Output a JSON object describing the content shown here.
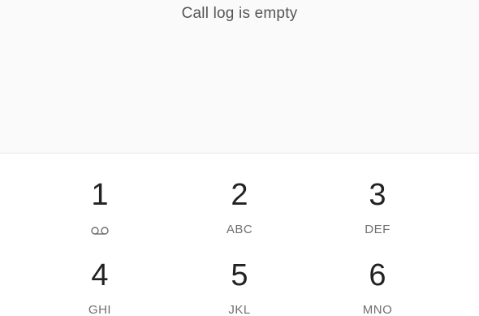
{
  "calllog": {
    "empty_message": "Call log is empty"
  },
  "keypad": {
    "keys": [
      {
        "digit": "1",
        "letters": "",
        "icon": "voicemail-icon"
      },
      {
        "digit": "2",
        "letters": "ABC"
      },
      {
        "digit": "3",
        "letters": "DEF"
      },
      {
        "digit": "4",
        "letters": "GHI"
      },
      {
        "digit": "5",
        "letters": "JKL"
      },
      {
        "digit": "6",
        "letters": "MNO"
      }
    ]
  }
}
